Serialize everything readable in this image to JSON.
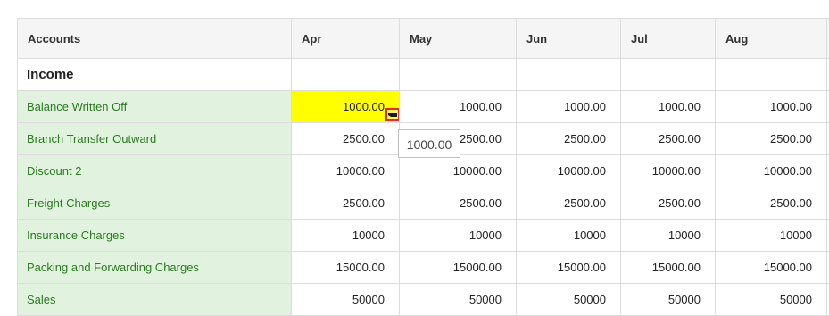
{
  "table": {
    "headers": [
      "Accounts",
      "Apr",
      "May",
      "Jun",
      "Jul",
      "Aug"
    ],
    "section_label": "Income",
    "rows": [
      {
        "account": "Balance Written Off",
        "values": [
          "1000.00",
          "1000.00",
          "1000.00",
          "1000.00",
          "1000.00"
        ]
      },
      {
        "account": "Branch Transfer Outward",
        "values": [
          "2500.00",
          "2500.00",
          "2500.00",
          "2500.00",
          "2500.00"
        ]
      },
      {
        "account": "Discount 2",
        "values": [
          "10000.00",
          "10000.00",
          "10000.00",
          "10000.00",
          "10000.00"
        ]
      },
      {
        "account": "Freight Charges",
        "values": [
          "2500.00",
          "2500.00",
          "2500.00",
          "2500.00",
          "2500.00"
        ]
      },
      {
        "account": "Insurance Charges",
        "values": [
          "10000",
          "10000",
          "10000",
          "10000",
          "10000"
        ]
      },
      {
        "account": "Packing and Forwarding Charges",
        "values": [
          "15000.00",
          "15000.00",
          "15000.00",
          "15000.00",
          "15000.00"
        ]
      },
      {
        "account": "Sales",
        "values": [
          "50000",
          "50000",
          "50000",
          "50000",
          "50000"
        ]
      }
    ]
  },
  "tooltip": {
    "text": "1000.00"
  },
  "icons": {
    "fill_handle": "pointing-hand-icon"
  },
  "colors": {
    "highlight": "#ffff00",
    "account_bg": "#e1f3df",
    "account_text": "#2a7a1f",
    "handle_border": "#e0301e"
  }
}
